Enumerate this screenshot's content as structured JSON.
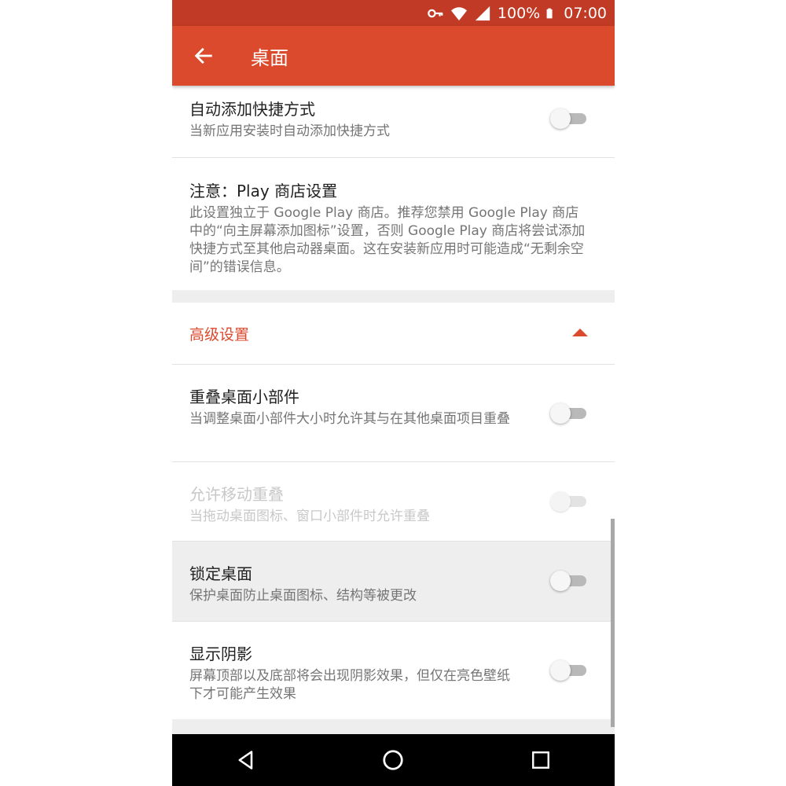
{
  "status_bar": {
    "battery_percent": "100%",
    "time": "07:00",
    "icons": [
      "key-icon",
      "wifi-icon",
      "signal-icon",
      "battery-icon"
    ]
  },
  "app_bar": {
    "title": "桌面",
    "back_icon": "arrow-left-icon"
  },
  "settings": {
    "auto_shortcut": {
      "title": "自动添加快捷方式",
      "subtitle": "当新应用安装时自动添加快捷方式",
      "enabled": false
    },
    "play_note": {
      "title": "注意：Play 商店设置",
      "subtitle": "此设置独立于 Google Play 商店。推荐您禁用 Google Play 商店中的“向主屏幕添加图标”设置，否则 Google Play 商店将尝试添加快捷方式至其他启动器桌面。这在安装新应用时可能造成“无剩余空间”的错误信息。"
    },
    "advanced_header": {
      "title": "高级设置",
      "expanded": true
    },
    "overlap_widgets": {
      "title": "重叠桌面小部件",
      "subtitle": "当调整桌面小部件大小时允许其与在其他桌面项目重叠",
      "enabled": false
    },
    "allow_move_overlap": {
      "title": "允许移动重叠",
      "subtitle": "当拖动桌面图标、窗口小部件时允许重叠",
      "enabled": false,
      "disabled": true
    },
    "lock_desktop": {
      "title": "锁定桌面",
      "subtitle": "保护桌面防止桌面图标、结构等被更改",
      "enabled": false
    },
    "show_shadow": {
      "title": "显示阴影",
      "subtitle": "屏幕顶部以及底部将会出现阴影效果，但仅在亮色壁纸下才可能产生效果",
      "enabled": false
    }
  },
  "nav_bar": {
    "buttons": [
      "back-triangle-icon",
      "home-circle-icon",
      "recents-square-icon"
    ]
  },
  "colors": {
    "accent": "#dc4a2d",
    "status_bar": "#c03a25"
  }
}
